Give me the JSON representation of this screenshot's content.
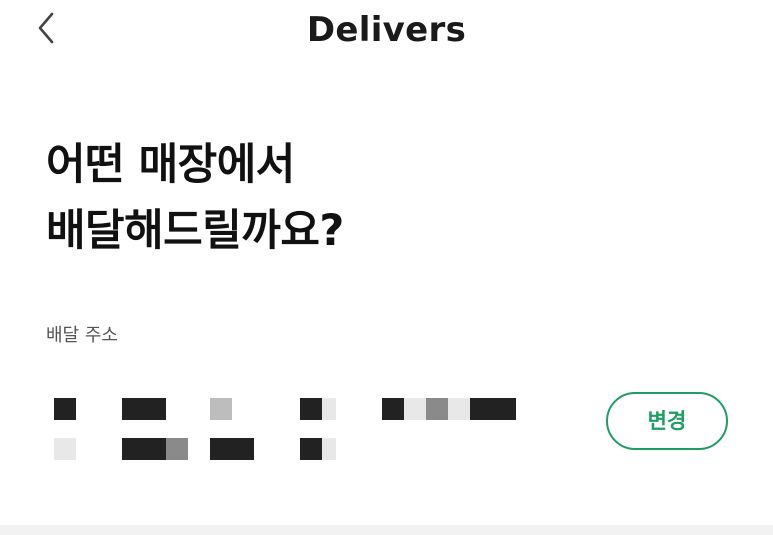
{
  "header": {
    "title": "Delivers",
    "back_icon": "chevron-left-icon"
  },
  "main": {
    "headline_line1": "어떤 매장에서",
    "headline_line2": "배달해드릴까요?",
    "address_label": "배달 주소",
    "address_redacted": true,
    "change_button_label": "변경",
    "accent_color": "#1f9d62"
  }
}
